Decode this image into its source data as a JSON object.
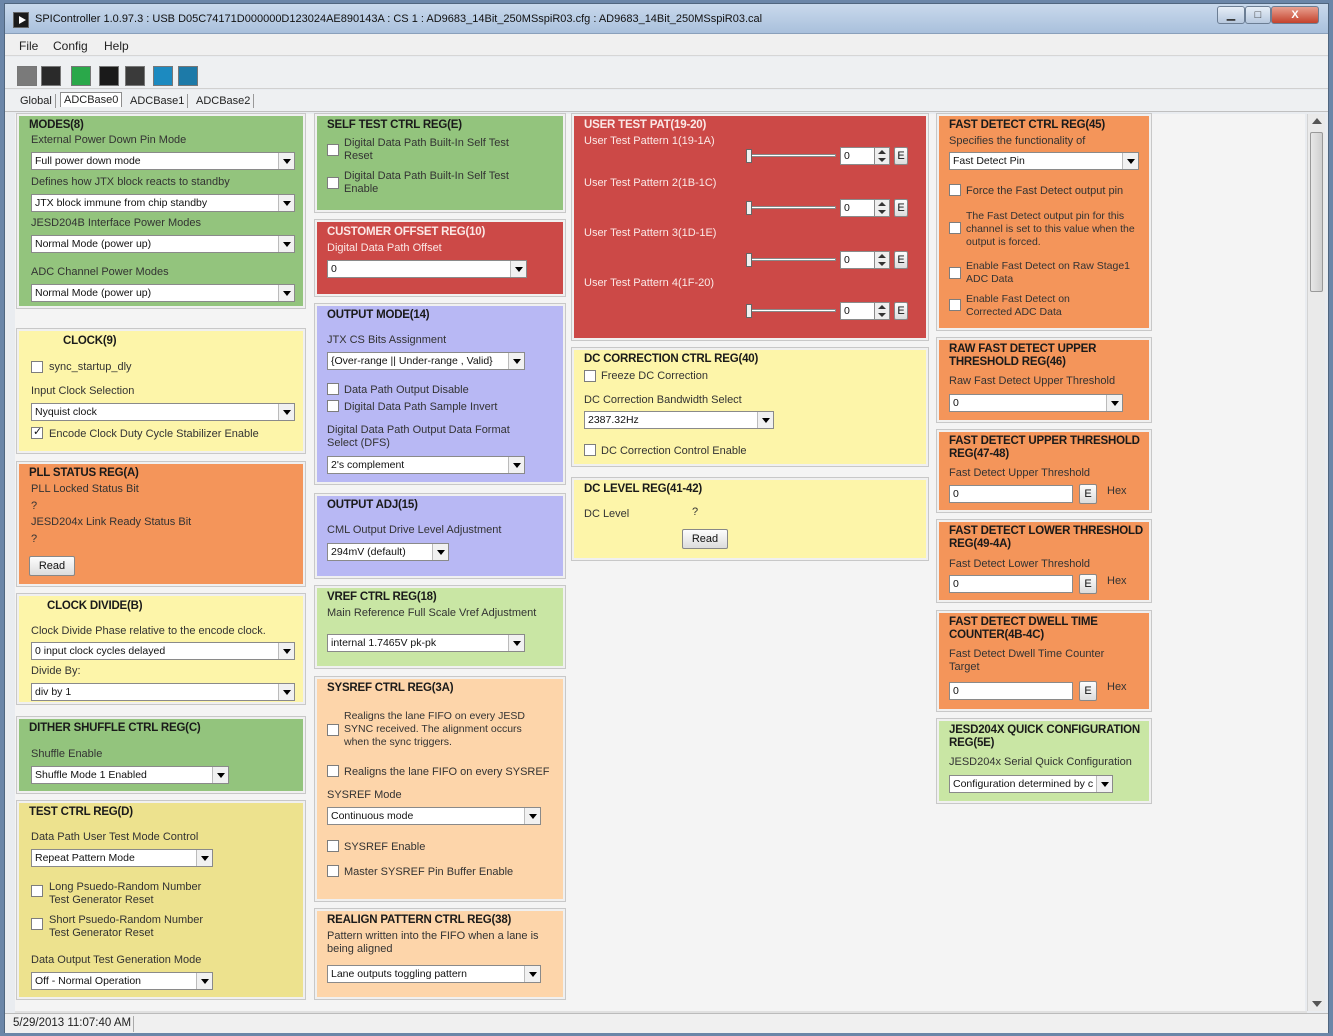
{
  "window": {
    "title": "SPIController 1.0.97.3 : USB D05C74171D000000D123024AE890143A : CS 1 : AD9683_14Bit_250MSspiR03.cfg : AD9683_14Bit_250MSspiR03.cal",
    "minimize": "▁",
    "maximize": "□",
    "close": "X"
  },
  "menu": [
    "File",
    "Config",
    "Help"
  ],
  "toolbar": {
    "icons": [
      "stop-icon",
      "save-icon",
      "new-icon",
      "read-icon",
      "register-icon",
      "chip-icon",
      "chart-icon"
    ]
  },
  "tabs": [
    "Global",
    "ADCBase0",
    "ADCBase1",
    "ADCBase2"
  ],
  "panels": {
    "modes": {
      "title": "MODES(8)",
      "lbl1": "External Power Down Pin Mode",
      "sel1": "Full power down mode",
      "lbl2": "Defines how JTX block reacts to standby",
      "sel2": "JTX block immune from chip standby",
      "lbl3": "JESD204B Interface Power Modes",
      "sel3": "Normal Mode (power up)",
      "lbl4": "ADC Channel Power Modes",
      "sel4": "Normal Mode (power up)"
    },
    "clock": {
      "title": "CLOCK(9)",
      "chk1": "sync_startup_dly",
      "lbl1": "Input Clock Selection",
      "sel1": "Nyquist clock",
      "chk2": "Encode Clock Duty Cycle Stabilizer Enable"
    },
    "pll": {
      "title": "PLL STATUS REG(A)",
      "lbl1": "PLL Locked Status Bit",
      "v1": "?",
      "lbl2": "JESD204x Link Ready Status Bit",
      "v2": "?",
      "read": "Read"
    },
    "clkdiv": {
      "title": "CLOCK DIVIDE(B)",
      "lbl1": "Clock Divide Phase relative to the encode clock.",
      "sel1": "0 input clock cycles delayed",
      "lbl2": "Divide By:",
      "sel2": "div by 1"
    },
    "dither": {
      "title": "DITHER SHUFFLE CTRL REG(C)",
      "lbl1": "Shuffle Enable",
      "sel1": "Shuffle Mode 1 Enabled"
    },
    "test": {
      "title": "TEST CTRL REG(D)",
      "lbl1": "Data Path User Test Mode Control",
      "sel1": "Repeat Pattern Mode",
      "chk1": "Long Psuedo-Random Number Test Generator Reset",
      "chk2": "Short Psuedo-Random Number Test Generator Reset",
      "lbl2": "Data Output Test Generation Mode",
      "sel2": "Off - Normal Operation"
    },
    "selftest": {
      "title": "SELF TEST CTRL REG(E)",
      "chk1": "Digital Data Path Built-In Self Test Reset",
      "chk2": "Digital Data Path Built-In Self Test Enable"
    },
    "custoff": {
      "title": "CUSTOMER OFFSET REG(10)",
      "lbl1": "Digital Data Path Offset",
      "sel1": "0"
    },
    "outmode": {
      "title": "OUTPUT MODE(14)",
      "lbl1": "JTX CS Bits Assignment",
      "sel1": "{Over-range || Under-range , Valid}",
      "chk1": "Data Path Output Disable",
      "chk2": "Digital Data Path Sample Invert",
      "lbl2": "Digital Data Path Output Data Format Select (DFS)",
      "sel2": "2's complement"
    },
    "outadj": {
      "title": "OUTPUT ADJ(15)",
      "lbl1": "CML Output Drive Level Adjustment",
      "sel1": "294mV (default)"
    },
    "vref": {
      "title": "VREF CTRL REG(18)",
      "lbl1": "Main Reference Full Scale Vref Adjustment",
      "sel1": "internal 1.7465V pk-pk"
    },
    "sysref": {
      "title": "SYSREF CTRL REG(3A)",
      "chk1": "Realigns the lane FIFO on every JESD SYNC received.  The alignment occurs when the sync triggers.",
      "chk2": "Realigns the lane FIFO on every SYSREF",
      "lbl1": "SYSREF Mode",
      "sel1": "Continuous mode",
      "chk3": "SYSREF Enable",
      "chk4": "Master SYSREF Pin Buffer Enable"
    },
    "realign": {
      "title": "REALIGN PATTERN CTRL REG(38)",
      "lbl1": "Pattern written into the FIFO when a lane is being aligned",
      "sel1": "Lane outputs toggling pattern"
    },
    "usertest": {
      "title": "USER TEST PAT(19-20)",
      "rows": [
        {
          "label": "User Test Pattern 1(19-1A)",
          "value": "0",
          "e": "E"
        },
        {
          "label": "User Test Pattern 2(1B-1C)",
          "value": "0",
          "e": "E"
        },
        {
          "label": "User Test Pattern 3(1D-1E)",
          "value": "0",
          "e": "E"
        },
        {
          "label": "User Test Pattern 4(1F-20)",
          "value": "0",
          "e": "E"
        }
      ]
    },
    "dccorr": {
      "title": "DC CORRECTION CTRL REG(40)",
      "chk1": "Freeze DC Correction",
      "lbl1": "DC Correction Bandwidth Select",
      "sel1": "2387.32Hz",
      "chk2": "DC Correction Control Enable"
    },
    "dclevel": {
      "title": "DC LEVEL REG(41-42)",
      "lbl1": "DC Level",
      "v1": "?",
      "read": "Read"
    },
    "fdctrl": {
      "title": "FAST DETECT CTRL REG(45)",
      "lbl1": "Specifies the functionality of",
      "sel1": "Fast Detect Pin",
      "chk1": "Force the Fast Detect output pin",
      "chk2": "The Fast Detect output pin for this channel is set to this value when the output is forced.",
      "chk3": "Enable Fast Detect on Raw Stage1 ADC Data",
      "chk4": "Enable Fast Detect on Corrected ADC Data"
    },
    "rawfd": {
      "title": "RAW FAST DETECT UPPER THRESHOLD REG(46)",
      "lbl1": "Raw Fast Detect Upper Threshold",
      "sel1": "0"
    },
    "fdupper": {
      "title": "FAST DETECT UPPER THRESHOLD REG(47-48)",
      "lbl1": "Fast Detect Upper Threshold",
      "v1": "0",
      "e": "E",
      "hex": "Hex"
    },
    "fdlower": {
      "title": "FAST DETECT LOWER THRESHOLD REG(49-4A)",
      "lbl1": "Fast Detect Lower Threshold",
      "v1": "0",
      "e": "E",
      "hex": "Hex"
    },
    "fddwell": {
      "title": "FAST DETECT DWELL TIME COUNTER(4B-4C)",
      "lbl1": "Fast Detect Dwell Time Counter Target",
      "v1": "0",
      "e": "E",
      "hex": "Hex"
    },
    "jesd": {
      "title": "JESD204X QUICK CONFIGURATION REG(5E)",
      "lbl1": "JESD204x Serial Quick Configuration",
      "sel1": "Configuration determined by c"
    }
  },
  "status": {
    "time": "5/29/2013 11:07:40 AM"
  }
}
